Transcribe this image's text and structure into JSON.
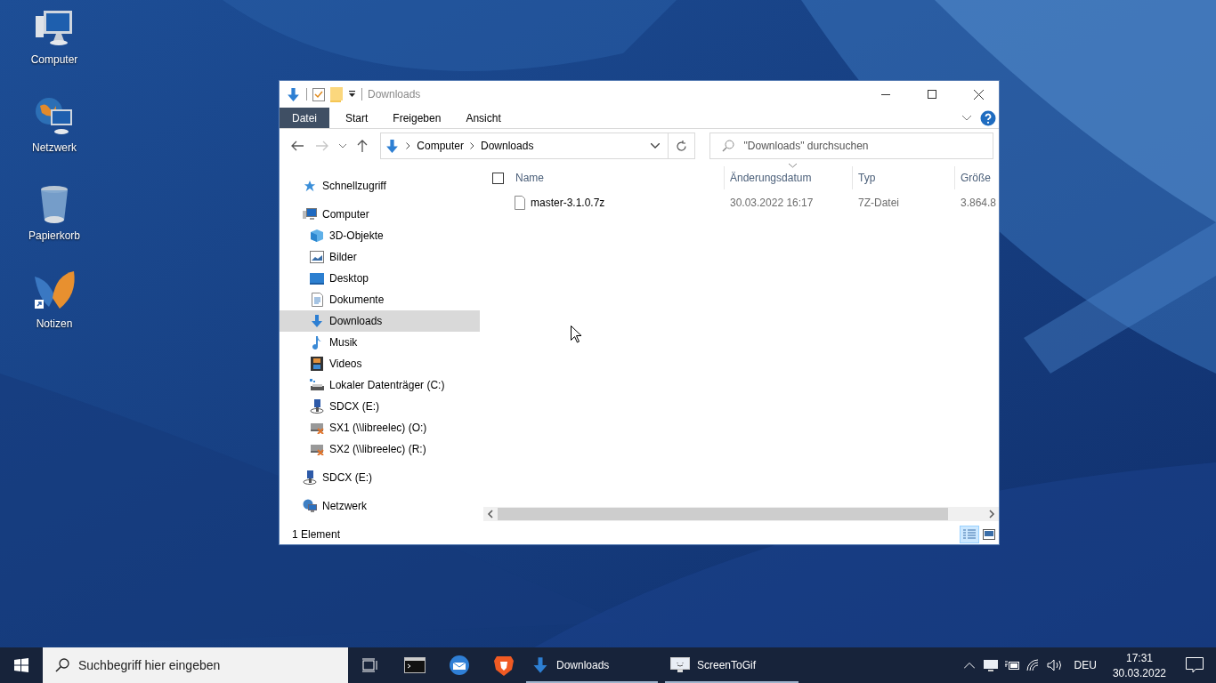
{
  "desktop_icons": [
    {
      "label": "Computer"
    },
    {
      "label": "Netzwerk"
    },
    {
      "label": "Papierkorb"
    },
    {
      "label": "Notizen"
    }
  ],
  "window": {
    "title": "Downloads",
    "ribbon_tabs": [
      {
        "label": "Datei",
        "selected": true
      },
      {
        "label": "Start",
        "selected": false
      },
      {
        "label": "Freigeben",
        "selected": false
      },
      {
        "label": "Ansicht",
        "selected": false
      }
    ],
    "address": {
      "crumbs": [
        "Computer",
        "Downloads"
      ]
    },
    "search": {
      "placeholder": "\"Downloads\" durchsuchen"
    },
    "nav": [
      {
        "label": "Schnellzugriff",
        "selected": false
      },
      {
        "label": "Computer",
        "selected": false,
        "children": [
          {
            "label": "3D-Objekte",
            "selected": false
          },
          {
            "label": "Bilder",
            "selected": false
          },
          {
            "label": "Desktop",
            "selected": false
          },
          {
            "label": "Dokumente",
            "selected": false
          },
          {
            "label": "Downloads",
            "selected": true
          },
          {
            "label": "Musik",
            "selected": false
          },
          {
            "label": "Videos",
            "selected": false
          },
          {
            "label": "Lokaler Datenträger (C:)",
            "selected": false
          },
          {
            "label": "SDCX (E:)",
            "selected": false
          },
          {
            "label": "SX1 (\\\\libreelec) (O:)",
            "selected": false
          },
          {
            "label": "SX2 (\\\\libreelec) (R:)",
            "selected": false
          }
        ]
      },
      {
        "label": "SDCX (E:)",
        "selected": false
      },
      {
        "label": "Netzwerk",
        "selected": false
      }
    ],
    "select_all": {
      "checked": false
    },
    "columns": [
      {
        "label": "Name",
        "sorted": false
      },
      {
        "label": "Änderungsdatum",
        "sorted": true
      },
      {
        "label": "Typ",
        "sorted": false
      },
      {
        "label": "Größe",
        "sorted": false
      }
    ],
    "rows": [
      {
        "name": "master-3.1.0.7z",
        "date": "30.03.2022 16:17",
        "type": "7Z-Datei",
        "size": "3.864.8",
        "selected": false
      }
    ],
    "status": "1 Element",
    "views": [
      {
        "kind": "details",
        "selected": true
      },
      {
        "kind": "large_icons",
        "selected": false
      }
    ]
  },
  "taskbar": {
    "search_placeholder": "Suchbegriff hier eingeben",
    "apps": [
      {
        "label": "Downloads",
        "running": true
      },
      {
        "label": "ScreenToGif",
        "running": true
      }
    ],
    "language": "DEU",
    "time": "17:31",
    "date": "30.03.2022"
  }
}
